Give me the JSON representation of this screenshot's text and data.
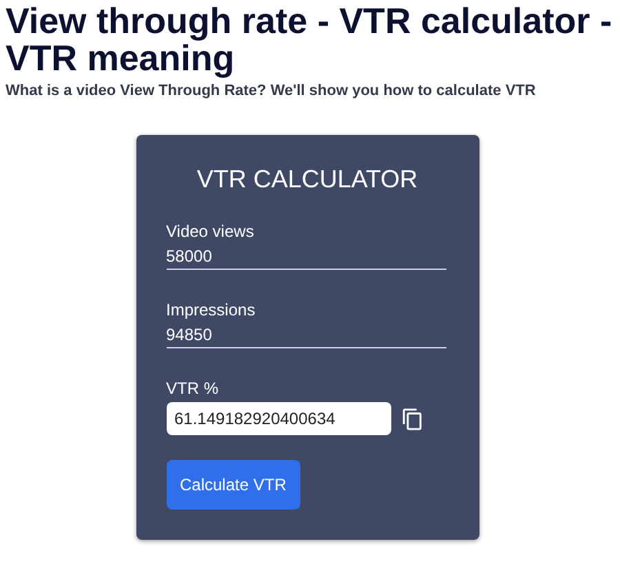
{
  "heading": "View through rate - VTR calculator - VTR meaning",
  "subtitle": "What is a video View Through Rate? We'll show you how to calculate VTR",
  "calculator": {
    "title": "VTR CALCULATOR",
    "fields": [
      {
        "kind": "underline",
        "label": "Video views",
        "value": "58000"
      },
      {
        "kind": "underline",
        "label": "Impressions",
        "value": "94850"
      },
      {
        "kind": "boxed",
        "label": "VTR %",
        "value": "61.149182920400634"
      }
    ],
    "button": "Calculate VTR"
  }
}
